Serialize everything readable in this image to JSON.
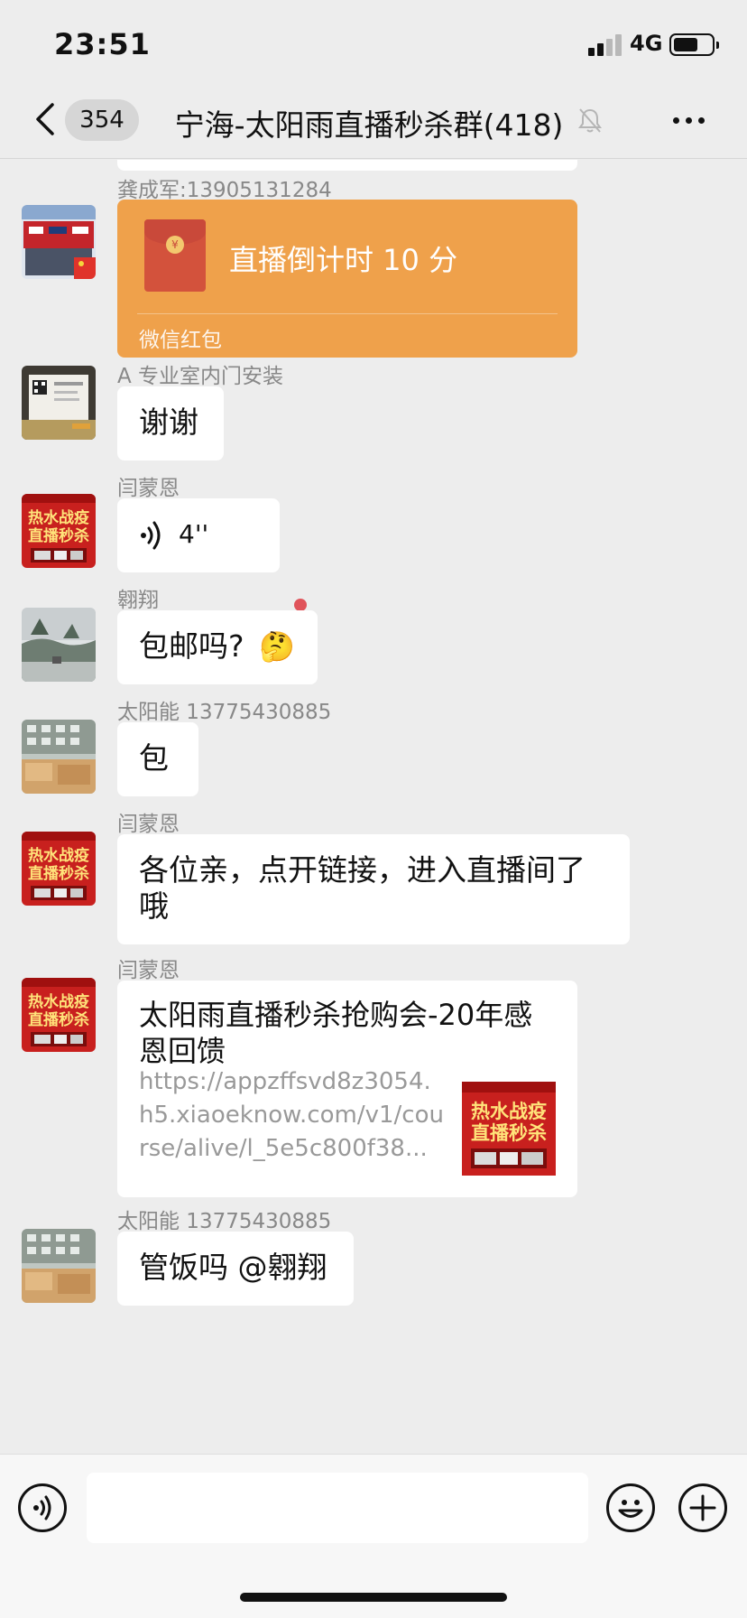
{
  "status_bar": {
    "time": "23:51",
    "network": "4G",
    "battery_level": 0.6,
    "signal_bars": 2
  },
  "nav": {
    "unread_count": "354",
    "title": "宁海-太阳雨直播秒杀群(418)",
    "back_icon": "chevron-left-icon",
    "mute_icon": "bell-muted-icon",
    "more_icon": "ellipsis-icon"
  },
  "messages": [
    {
      "type": "red_packet",
      "sender": "龚成军:13905131284",
      "avatar": "store-photo-avatar",
      "text": "直播倒计时 10 分",
      "label": "微信红包",
      "color": "#efa14b"
    },
    {
      "type": "text",
      "sender": "A 专业室内门安装",
      "avatar": "business-card-avatar",
      "text": "谢谢"
    },
    {
      "type": "voice",
      "sender": "闫蒙恩",
      "avatar": "promo-poster-avatar",
      "duration": "4''",
      "unread": true
    },
    {
      "type": "text",
      "sender": "翱翔",
      "avatar": "landscape-avatar",
      "text": "包邮吗?",
      "emoji": "🤔"
    },
    {
      "type": "text",
      "sender": "太阳能 13775430885",
      "avatar": "building-avatar",
      "text": "包"
    },
    {
      "type": "text",
      "sender": "闫蒙恩",
      "avatar": "promo-poster-avatar",
      "text": "各位亲，点开链接，进入直播间了哦"
    },
    {
      "type": "link",
      "sender": "闫蒙恩",
      "avatar": "promo-poster-avatar",
      "title": "太阳雨直播秒杀抢购会-20年感恩回馈",
      "url": "https://appzffsvd8z3054.h5.xiaoeknow.com/v1/course/alive/l_5e5c800f38...",
      "thumbnail": "promo-poster-thumbnail"
    },
    {
      "type": "text",
      "sender": "太阳能 13775430885",
      "avatar": "building-avatar",
      "text": "管饭吗 @翱翔"
    }
  ],
  "input_bar": {
    "voice_icon": "voice-mode-icon",
    "emoji_icon": "emoji-icon",
    "plus_icon": "plus-icon",
    "placeholder": ""
  },
  "colors": {
    "background": "#ededed",
    "red_packet": "#efa14b",
    "unread_dot": "#e0535a",
    "poster_red": "#c8201e"
  }
}
